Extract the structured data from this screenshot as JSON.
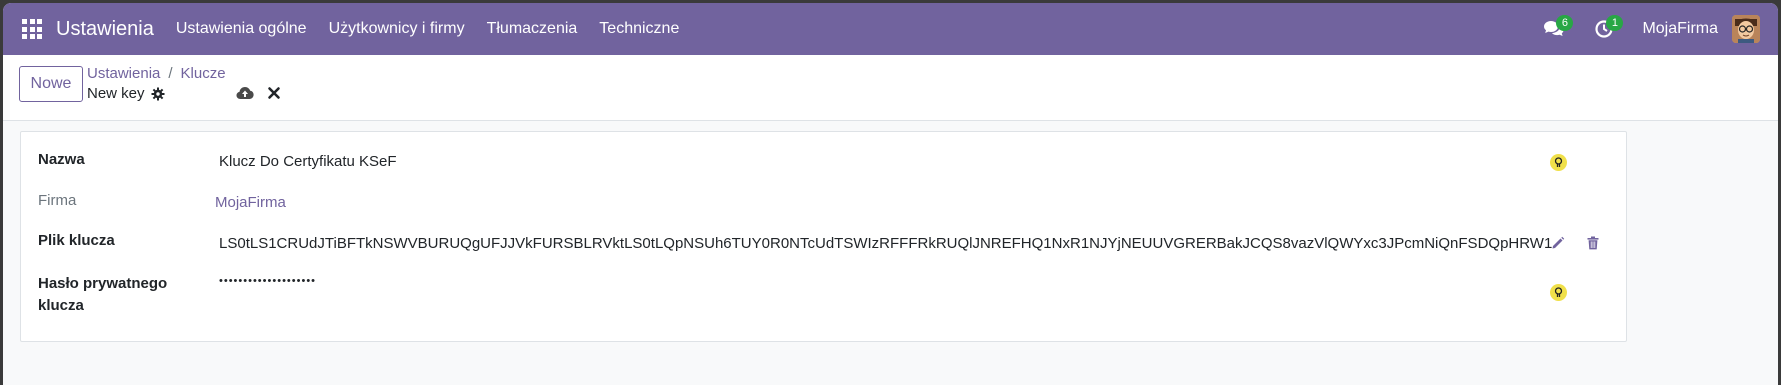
{
  "navbar": {
    "app_name": "Ustawienia",
    "menu": [
      "Ustawienia ogólne",
      "Użytkownicy i firmy",
      "Tłumaczenia",
      "Techniczne"
    ],
    "messages_count": "6",
    "activities_count": "1",
    "company": "MojaFirma"
  },
  "control": {
    "new_label": "Nowe",
    "breadcrumb": [
      "Ustawienia",
      "Klucze"
    ],
    "breadcrumb_sep": "/",
    "record_title": "New key"
  },
  "form": {
    "name_label": "Nazwa",
    "name_value": "Klucz Do Certyfikatu KSeF",
    "company_label": "Firma",
    "company_value": "MojaFirma",
    "file_label": "Plik klucza",
    "file_value": "LS0tLS1CRUdJTiBFTkNSWVBURUQgUFJJVkFURSBLRVktLS0tLQpNSUh6TUY0R0NTcUdTSWIzRFFFRkRUQlJNREFHQ1NxR1NJYjNEUUVGRERBakJCQS8vazVlQWYxc3JPcmNiQnFSDQpHRW1",
    "password_label_line1": "Hasło prywatnego",
    "password_label_line2": "klucza",
    "password_value": "••••••••••••••••••••"
  },
  "colors": {
    "brand": "#71639e",
    "badge": "#28a745",
    "key_icon": "#f0e04a"
  },
  "icons": [
    "apps-icon",
    "chat-icon",
    "clock-icon",
    "gear-icon",
    "cloud-upload-icon",
    "close-icon",
    "key-icon",
    "pencil-icon",
    "trash-icon"
  ]
}
